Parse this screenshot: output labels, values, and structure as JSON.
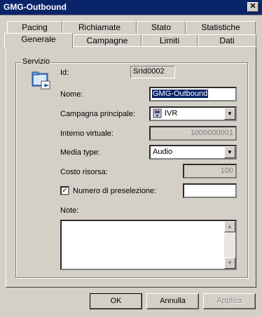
{
  "window": {
    "title": "GMG-Outbound"
  },
  "tabs_row1": [
    "Pacing",
    "Richiamate",
    "Stato",
    "Statistiche"
  ],
  "tabs_row2": [
    "Generale",
    "Campagne",
    "Limiti",
    "Dati"
  ],
  "group": {
    "label": "Servizio"
  },
  "form": {
    "id_label": "Id:",
    "id_value": "SrId0002",
    "nome_label": "Nome:",
    "nome_value": "GMG-Outbound",
    "campagna_label": "Campagna principale:",
    "campagna_value": "IVR",
    "interno_label": "Interno virtuale:",
    "interno_value": "1000000001",
    "media_label": "Media type:",
    "media_value": "Audio",
    "costo_label": "Costo risorsa:",
    "costo_value": "100",
    "prefix_label": "Numero di preselezione:",
    "prefix_value": "",
    "prefix_checked": true,
    "note_label": "Note:"
  },
  "buttons": {
    "ok": "OK",
    "annulla": "Annulla",
    "applica": "Applica"
  },
  "colors": {
    "titlebar": "#0a246a",
    "face": "#d4d0c8",
    "selection": "#0a246a"
  }
}
